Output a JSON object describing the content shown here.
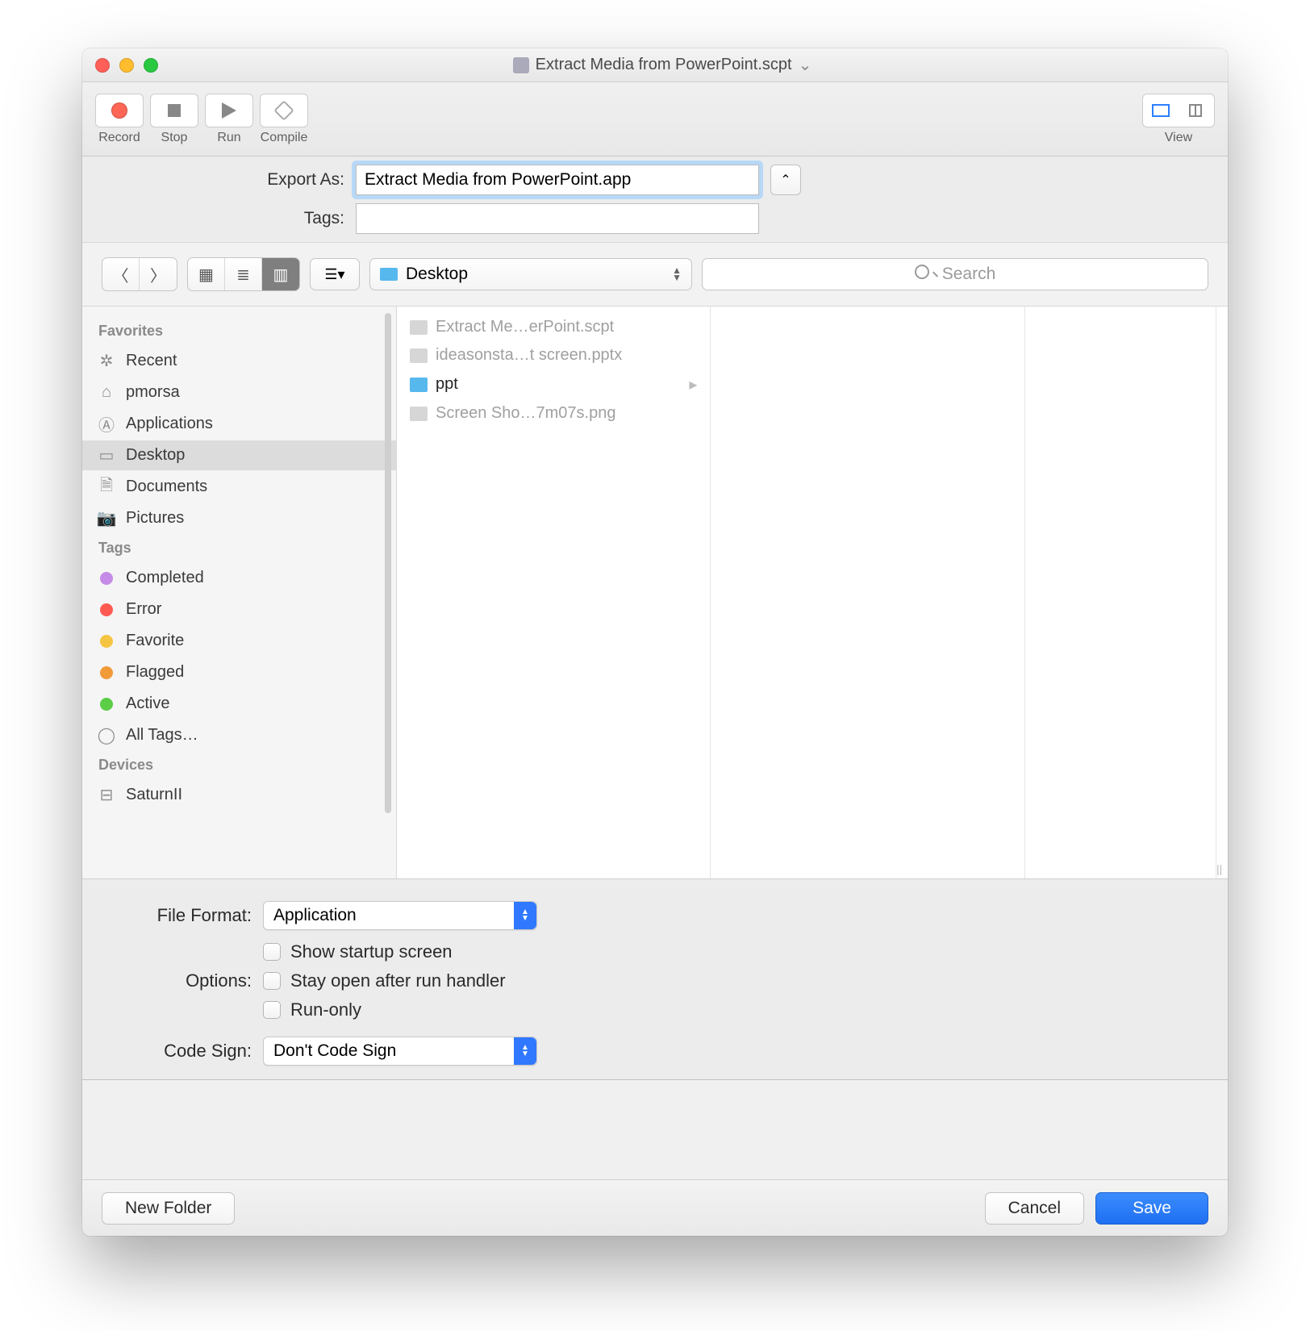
{
  "window": {
    "title": "Extract Media from PowerPoint.scpt"
  },
  "toolbar": {
    "record": "Record",
    "stop": "Stop",
    "run": "Run",
    "compile": "Compile",
    "view": "View"
  },
  "sheet": {
    "export_as_label": "Export As:",
    "export_as_value": "Extract Media from PowerPoint.app",
    "tags_label": "Tags:",
    "tags_value": ""
  },
  "browser": {
    "location": "Desktop",
    "search_placeholder": "Search",
    "sidebar": {
      "favorites_label": "Favorites",
      "favorites": [
        {
          "icon": "recent",
          "label": "Recent"
        },
        {
          "icon": "home",
          "label": "pmorsa"
        },
        {
          "icon": "apps",
          "label": "Applications"
        },
        {
          "icon": "desktop",
          "label": "Desktop",
          "selected": true
        },
        {
          "icon": "docs",
          "label": "Documents"
        },
        {
          "icon": "pics",
          "label": "Pictures"
        }
      ],
      "tags_label": "Tags",
      "tags": [
        {
          "color": "#c58be6",
          "label": "Completed"
        },
        {
          "color": "#ff5a52",
          "label": "Error"
        },
        {
          "color": "#f5c443",
          "label": "Favorite"
        },
        {
          "color": "#f19a38",
          "label": "Flagged"
        },
        {
          "color": "#5bcd47",
          "label": "Active"
        },
        {
          "color": "",
          "label": "All Tags…",
          "all": true
        }
      ],
      "devices_label": "Devices",
      "devices": [
        {
          "icon": "disk",
          "label": "SaturnII"
        }
      ]
    },
    "files": [
      {
        "name": "Extract Me…erPoint.scpt",
        "enabled": false,
        "folder": false
      },
      {
        "name": "ideasonsta…t screen.pptx",
        "enabled": false,
        "folder": false
      },
      {
        "name": "ppt",
        "enabled": true,
        "folder": true
      },
      {
        "name": "Screen Sho…7m07s.png",
        "enabled": false,
        "folder": false
      }
    ]
  },
  "options": {
    "file_format_label": "File Format:",
    "file_format_value": "Application",
    "options_label": "Options:",
    "checks": [
      "Show startup screen",
      "Stay open after run handler",
      "Run-only"
    ],
    "code_sign_label": "Code Sign:",
    "code_sign_value": "Don't Code Sign"
  },
  "buttons": {
    "new_folder": "New Folder",
    "cancel": "Cancel",
    "save": "Save"
  }
}
